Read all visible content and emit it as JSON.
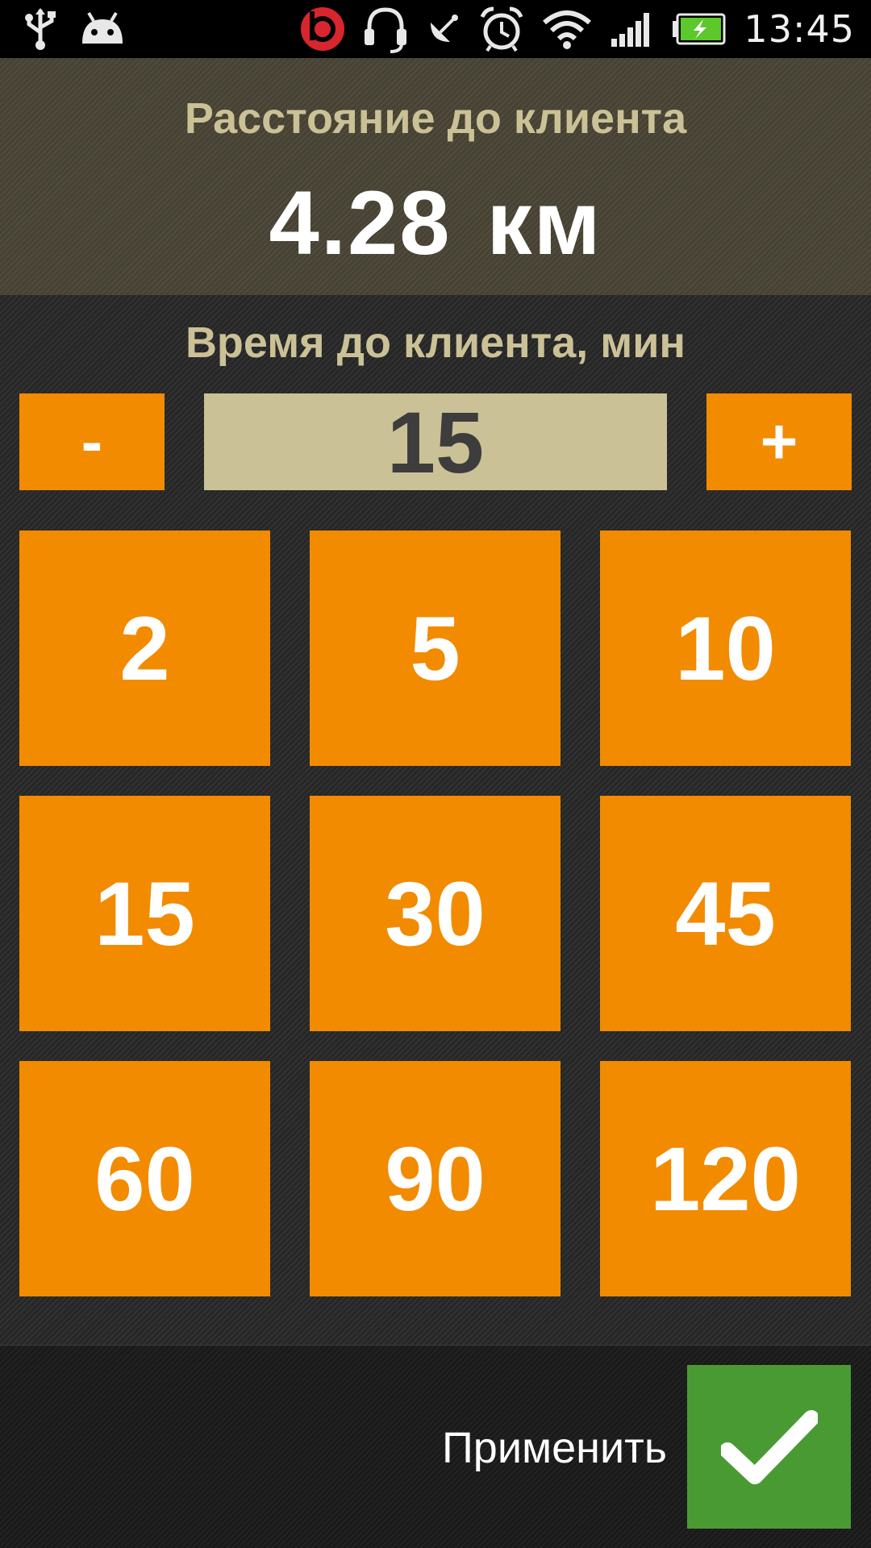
{
  "status_bar": {
    "time": "13:45",
    "icons": [
      "usb-icon",
      "android-debug-icon",
      "beats-audio-icon",
      "headset-icon",
      "satellite-icon",
      "alarm-icon",
      "wifi-icon",
      "signal-icon",
      "battery-charging-icon"
    ]
  },
  "distance": {
    "label": "Расстояние до клиента",
    "value": "4.28",
    "unit": "км"
  },
  "time_to_client": {
    "label": "Время до клиента, мин",
    "minus_label": "-",
    "plus_label": "+",
    "current_value": "15",
    "presets": [
      "2",
      "5",
      "10",
      "15",
      "30",
      "45",
      "60",
      "90",
      "120"
    ]
  },
  "footer": {
    "apply_label": "Применить",
    "apply_icon": "checkmark-icon"
  },
  "colors": {
    "accent_orange": "#f28b00",
    "value_field_bg": "#cbc196",
    "label_beige": "#cbc196",
    "apply_green": "#4a9a34"
  }
}
